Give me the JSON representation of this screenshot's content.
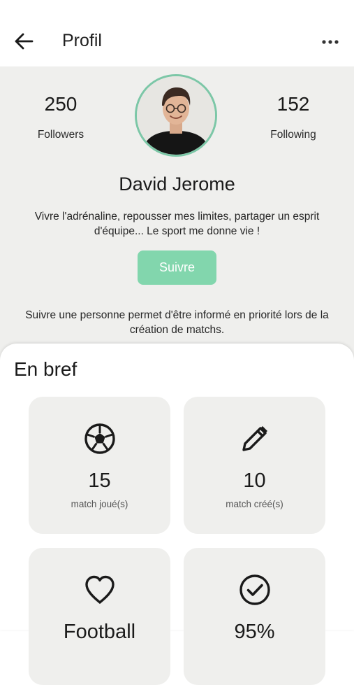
{
  "header": {
    "title": "Profil",
    "back_icon": "arrow-left-icon",
    "more_icon": "more-horizontal-icon"
  },
  "profile": {
    "followers_count": "250",
    "followers_label": "Followers",
    "following_count": "152",
    "following_label": "Following",
    "name": "David Jerome",
    "bio": "Vivre l'adrénaline, repousser mes limites, partager un esprit d'équipe... Le sport me donne vie !",
    "follow_button": "Suivre",
    "follow_note": "Suivre une personne permet d'être informé en priorité lors de la création de matchs."
  },
  "summary": {
    "title": "En bref",
    "cards": [
      {
        "icon": "soccer-ball-icon",
        "value": "15",
        "label": "match joué(s)"
      },
      {
        "icon": "pencil-icon",
        "value": "10",
        "label": "match créé(s)"
      },
      {
        "icon": "heart-icon",
        "value": "Football",
        "label": ""
      },
      {
        "icon": "check-circle-icon",
        "value": "95%",
        "label": ""
      }
    ]
  },
  "colors": {
    "accent": "#82d6ad",
    "avatar_ring": "#7cc7a7",
    "panel_bg": "#efefed"
  }
}
